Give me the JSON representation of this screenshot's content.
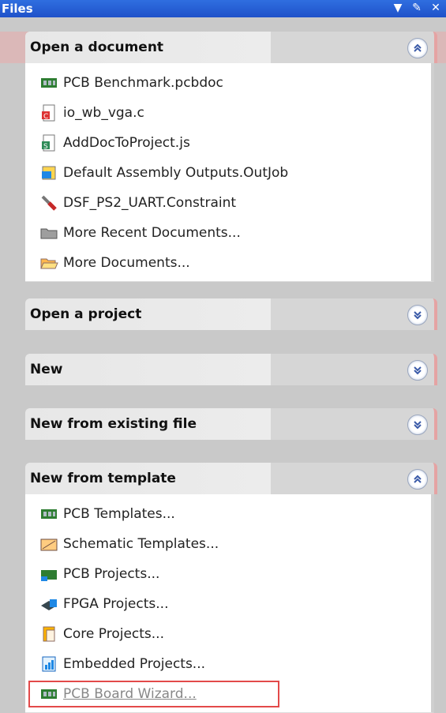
{
  "window": {
    "title": "Files"
  },
  "sections": [
    {
      "title": "Open a document",
      "expanded": true,
      "items": [
        {
          "label": "PCB Benchmark.pcbdoc",
          "icon": "pcb-icon"
        },
        {
          "label": "io_wb_vga.c",
          "icon": "c-file-icon"
        },
        {
          "label": "AddDocToProject.js",
          "icon": "script-file-icon"
        },
        {
          "label": "Default Assembly Outputs.OutJob",
          "icon": "outjob-icon"
        },
        {
          "label": "DSF_PS2_UART.Constraint",
          "icon": "constraint-icon"
        },
        {
          "label": "More Recent Documents...",
          "icon": "folder-icon"
        },
        {
          "label": "More Documents...",
          "icon": "open-folder-icon"
        }
      ]
    },
    {
      "title": "Open a project",
      "expanded": false
    },
    {
      "title": "New",
      "expanded": false
    },
    {
      "title": "New from existing file",
      "expanded": false
    },
    {
      "title": "New from template",
      "expanded": true,
      "items": [
        {
          "label": "PCB Templates...",
          "icon": "pcb-icon"
        },
        {
          "label": "Schematic Templates...",
          "icon": "schematic-icon"
        },
        {
          "label": "PCB Projects...",
          "icon": "pcb-project-icon"
        },
        {
          "label": "FPGA Projects...",
          "icon": "fpga-icon"
        },
        {
          "label": "Core Projects...",
          "icon": "core-project-icon"
        },
        {
          "label": "Embedded Projects...",
          "icon": "embedded-icon"
        },
        {
          "label": "PCB Board Wizard...",
          "icon": "pcb-icon"
        }
      ]
    }
  ]
}
